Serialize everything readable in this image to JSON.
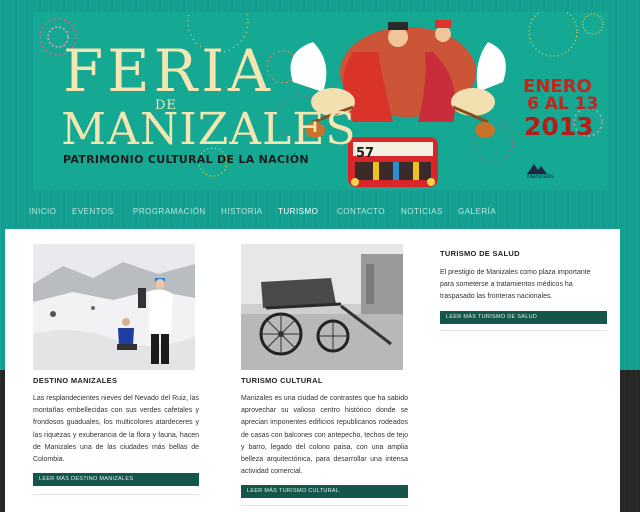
{
  "banner": {
    "title_feria": "FERIA",
    "title_de": "DE",
    "title_manizales": "MANIZALES",
    "subtitle": "PATRIMONIO CULTURAL DE LA NACIÓN",
    "date_month": "ENERO",
    "date_days": "6 AL 13",
    "date_year": "2013",
    "bus_number": "57",
    "logo_text": "Manizales"
  },
  "nav": {
    "items": [
      {
        "label": "INICIO"
      },
      {
        "label": "EVENTOS"
      },
      {
        "label": "PROGRAMACIÓN"
      },
      {
        "label": "HISTORIA"
      },
      {
        "label": "TURISMO"
      },
      {
        "label": "CONTACTO"
      },
      {
        "label": "NOTICIAS"
      },
      {
        "label": "GALERÍA"
      }
    ],
    "active": "TURISMO"
  },
  "columns": [
    {
      "title": "DESTINO MANIZALES",
      "text": "Las resplandecientes nieves del Nevado del Ruiz, las montañas embellecidas con sus verdes cafetales y frondosos guaduales, los multicolores atardeceres y las riquezas y exuberancia de la flora y fauna, hacen de Manizales una de las ciudades más bellas de Colombia.",
      "button": "LEER MÁS DESTINO MANIZALES"
    },
    {
      "title": "TURISMO CULTURAL",
      "text": "Manizales es una ciudad de contrastes que ha sabido aprovechar su valioso centro histórico donde se aprecian imponentes edificios republicanos rodeados de casas con balcones con antepecho, techos de tejo y barro, legado del colono paisa, con una amplia belleza arquitectónica, para desarrollar una intensa actividad comercial.",
      "button": "LEER MÁS TURISMO CULTURAL"
    },
    {
      "title": "TURISMO DE SALUD",
      "text": "El prestigio de Manizales como plaza importante para someterse a tratamientos médicos ha traspasado las fronteras nacionales.",
      "button": "LEER MÁS TURISMO DE SALUD"
    }
  ],
  "colors": {
    "teal": "#129f8f",
    "button": "#14564b",
    "title_cream": "#f3e6b3",
    "date_red": "#c0261d"
  }
}
